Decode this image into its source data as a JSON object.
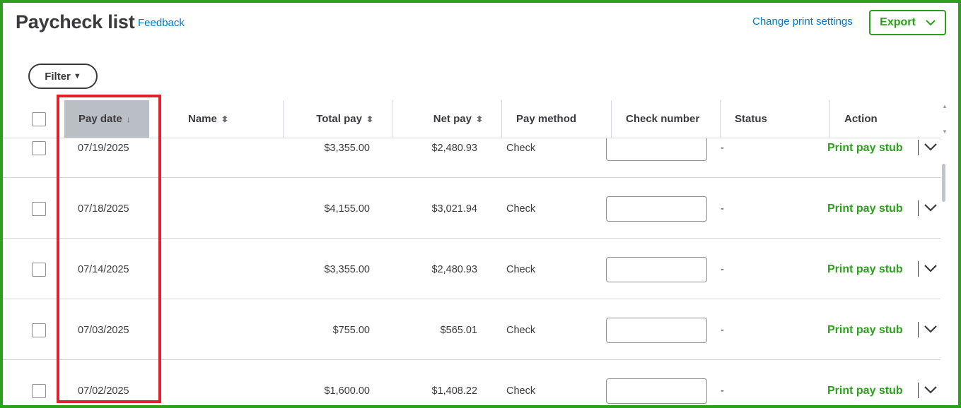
{
  "page": {
    "title": "Paycheck list",
    "feedback_label": "Feedback",
    "print_settings_label": "Change print settings",
    "export_label": "Export",
    "filter_label": "Filter"
  },
  "table": {
    "columns": {
      "pay_date": "Pay date",
      "name": "Name",
      "total_pay": "Total pay",
      "net_pay": "Net pay",
      "pay_method": "Pay method",
      "check_number": "Check number",
      "status": "Status",
      "action": "Action"
    },
    "sorted_column": "Pay date",
    "sort_direction": "descending",
    "rows": [
      {
        "pay_date": "07/19/2025",
        "name": "",
        "total_pay": "$3,355.00",
        "net_pay": "$2,480.93",
        "pay_method": "Check",
        "check_number": "",
        "status": "-",
        "action": "Print pay stub"
      },
      {
        "pay_date": "07/18/2025",
        "name": "",
        "total_pay": "$4,155.00",
        "net_pay": "$3,021.94",
        "pay_method": "Check",
        "check_number": "",
        "status": "-",
        "action": "Print pay stub"
      },
      {
        "pay_date": "07/14/2025",
        "name": "",
        "total_pay": "$3,355.00",
        "net_pay": "$2,480.93",
        "pay_method": "Check",
        "check_number": "",
        "status": "-",
        "action": "Print pay stub"
      },
      {
        "pay_date": "07/03/2025",
        "name": "",
        "total_pay": "$755.00",
        "net_pay": "$565.01",
        "pay_method": "Check",
        "check_number": "",
        "status": "-",
        "action": "Print pay stub"
      },
      {
        "pay_date": "07/02/2025",
        "name": "",
        "total_pay": "$1,600.00",
        "net_pay": "$1,408.22",
        "pay_method": "Check",
        "check_number": "",
        "status": "-",
        "action": "Print pay stub"
      }
    ]
  },
  "colors": {
    "brand_green": "#2ca01c",
    "link_blue": "#0077c5",
    "highlight_red": "#e0202a",
    "active_header": "#babec5"
  }
}
